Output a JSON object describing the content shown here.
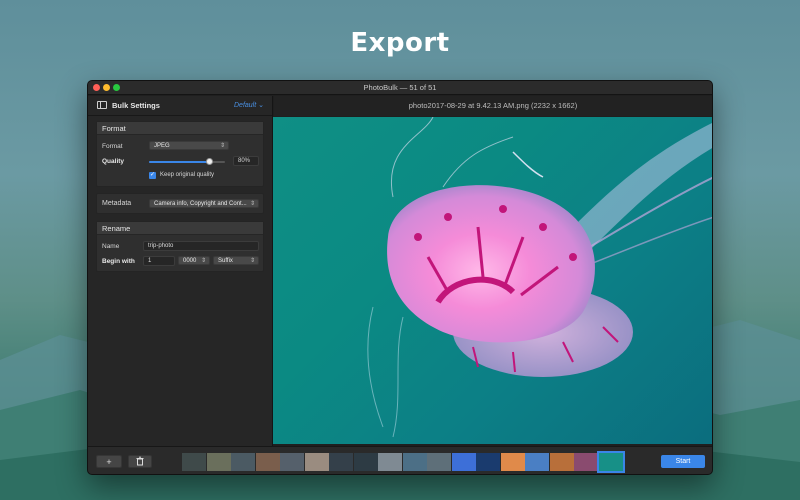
{
  "hero": {
    "title": "Export"
  },
  "window": {
    "title": "PhotoBulk — 51 of 51"
  },
  "sidebar": {
    "title": "Bulk Settings",
    "preset": "Default ⌄",
    "format_group": {
      "header": "Format",
      "format_label": "Format",
      "format_value": "JPEG",
      "quality_label": "Quality",
      "quality_value": "80%",
      "quality_fraction": 0.8,
      "keep_quality_label": "Keep original quality",
      "keep_quality_checked": true
    },
    "metadata_group": {
      "label": "Metadata",
      "value": "Camera info, Copyright and Cont..."
    },
    "rename_group": {
      "header": "Rename",
      "name_label": "Name",
      "name_value": "trip-photo",
      "begin_label": "Begin with",
      "begin_value": "1",
      "digits_value": "0000",
      "position_value": "Suffix"
    }
  },
  "preview": {
    "title": "photo2017-08-29 at 9.42.13 AM.png (2232 x 1662)"
  },
  "bottombar": {
    "add_label": "+",
    "delete_icon": "trash-icon",
    "start_label": "Start",
    "thumbnails": [
      {
        "color": "#3f4a4a"
      },
      {
        "color": "#6a6f5c"
      },
      {
        "color": "#4b5a63"
      },
      {
        "color": "#7a5e4c"
      },
      {
        "color": "#55606b"
      },
      {
        "color": "#9a8c80"
      },
      {
        "color": "#34404a"
      },
      {
        "color": "#2d3b44"
      },
      {
        "color": "#7f8a93"
      },
      {
        "color": "#4c6f86"
      },
      {
        "color": "#5e6f79"
      },
      {
        "color": "#3d6fd8"
      },
      {
        "color": "#1a3b6e"
      },
      {
        "color": "#e08a4a"
      },
      {
        "color": "#4a7fc4"
      },
      {
        "color": "#b86f3a"
      },
      {
        "color": "#8a4b6f"
      },
      {
        "color": "#179087"
      }
    ],
    "selected_index": 17
  },
  "colors": {
    "accent": "#3a86e8",
    "window_bg": "#1f1f1f",
    "sidebar_bg": "#262626",
    "preview_bg": "#0f8f85"
  }
}
